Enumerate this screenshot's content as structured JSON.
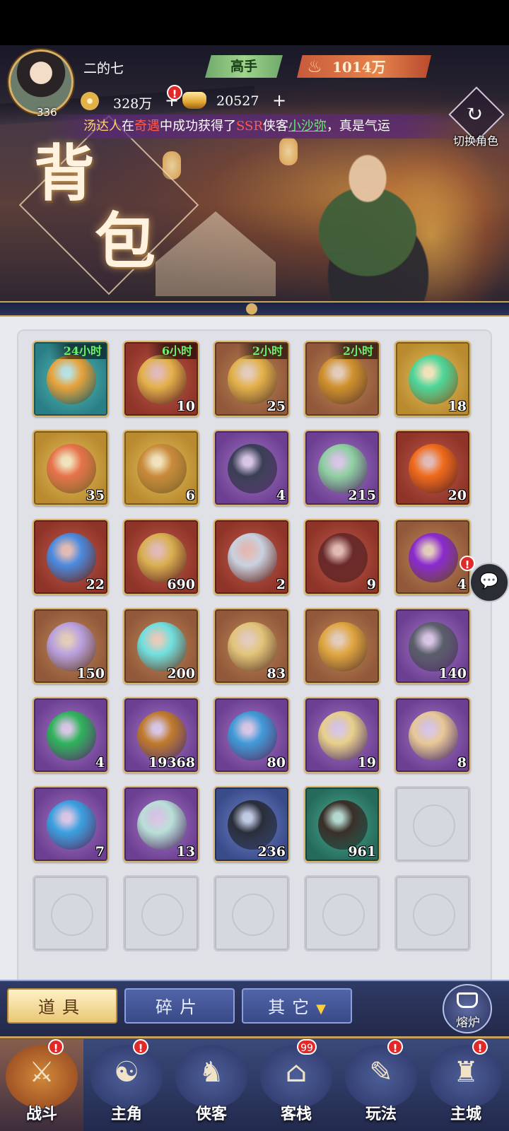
{
  "header": {
    "player_name": "二的七",
    "level": "336",
    "rank": "高手",
    "power": "1014万",
    "copper": "328万",
    "gold": "20527",
    "plus": "+",
    "alert": "!",
    "switch_role_label": "切换角色",
    "page_title_1": "背",
    "page_title_2": "包",
    "ticker": {
      "p1": "汤达人",
      "p2": "在",
      "p3": "奇遇",
      "p4": "中成功获得了",
      "p5": "SSR",
      "p6": "侠客",
      "p7": "小沙弥",
      "p8": "，真是气运"
    }
  },
  "items": [
    {
      "rarity": "teal",
      "timer": "24小时",
      "count": "",
      "icon": "gold-orbs-hourglass-icon",
      "color": "#e8a23a"
    },
    {
      "rarity": "red",
      "timer": "6小时",
      "count": "10",
      "icon": "coins-hourglass-icon",
      "color": "#e3b14a"
    },
    {
      "rarity": "orange",
      "timer": "2小时",
      "count": "25",
      "icon": "coin-hourglass-icon",
      "color": "#e3b14a"
    },
    {
      "rarity": "orange",
      "timer": "2小时",
      "count": "",
      "icon": "orbs-scroll-hourglass-icon",
      "color": "#d0902c"
    },
    {
      "rarity": "gold",
      "timer": "",
      "count": "18",
      "icon": "green-jade-icon",
      "color": "#4ed69a"
    },
    {
      "rarity": "gold",
      "timer": "",
      "count": "35",
      "icon": "hero-invite-card-icon",
      "color": "#e6724a"
    },
    {
      "rarity": "gold",
      "timer": "",
      "count": "6",
      "icon": "roast-chicken-icon",
      "color": "#c98a3a"
    },
    {
      "rarity": "purple",
      "timer": "",
      "count": "4",
      "icon": "dark-ore-icon",
      "color": "#3a3f55"
    },
    {
      "rarity": "purple",
      "timer": "",
      "count": "215",
      "icon": "recruit-book-icon",
      "color": "#8ed0a0"
    },
    {
      "rarity": "red",
      "timer": "",
      "count": "20",
      "icon": "fire-orb-icon",
      "color": "#f06a1a"
    },
    {
      "rarity": "red",
      "timer": "",
      "count": "22",
      "icon": "rainbow-crystal-icon",
      "color": "#4a8ae0"
    },
    {
      "rarity": "red",
      "timer": "",
      "count": "690",
      "icon": "scroll-roll-icon",
      "color": "#d9b050"
    },
    {
      "rarity": "red",
      "timer": "",
      "count": "2",
      "icon": "torn-cloth-icon",
      "color": "#c9d2e0"
    },
    {
      "rarity": "red",
      "timer": "",
      "count": "9",
      "icon": "wine-jar-icon",
      "color": "#6a2a2a"
    },
    {
      "rarity": "orange",
      "timer": "",
      "count": "4",
      "icon": "purple-orb-icon",
      "color": "#8a2ad0"
    },
    {
      "rarity": "orange",
      "timer": "",
      "count": "150",
      "icon": "star-cloth-icon",
      "color": "#b9a0e0"
    },
    {
      "rarity": "orange",
      "timer": "",
      "count": "200",
      "icon": "aqua-stone-icon",
      "color": "#6fe0e0"
    },
    {
      "rarity": "orange",
      "timer": "",
      "count": "83",
      "icon": "ancient-scroll-icon",
      "color": "#e2c47a"
    },
    {
      "rarity": "orange",
      "timer": "",
      "count": "",
      "icon": "gourd-icon",
      "color": "#e0a640"
    },
    {
      "rarity": "purple",
      "timer": "",
      "count": "140",
      "icon": "iron-ore-icon",
      "color": "#5a5e6a"
    },
    {
      "rarity": "purple",
      "timer": "",
      "count": "4",
      "icon": "green-orb-icon",
      "color": "#2fb35a"
    },
    {
      "rarity": "purple",
      "timer": "",
      "count": "19368",
      "icon": "bronze-orb-icon",
      "color": "#c07a2a"
    },
    {
      "rarity": "purple",
      "timer": "",
      "count": "80",
      "icon": "tri-crystal-icon",
      "color": "#3f9ad8"
    },
    {
      "rarity": "purple",
      "timer": "",
      "count": "19",
      "icon": "gold-talisman-icon",
      "color": "#e8d08a"
    },
    {
      "rarity": "purple",
      "timer": "",
      "count": "8",
      "icon": "jade-token-icon",
      "color": "#e8c896"
    },
    {
      "rarity": "purple",
      "timer": "",
      "count": "7",
      "icon": "blue-banner-icon",
      "color": "#3aa0e0"
    },
    {
      "rarity": "purple",
      "timer": "",
      "count": "13",
      "icon": "tea-jar-icon",
      "color": "#b9e0d8"
    },
    {
      "rarity": "blue",
      "timer": "",
      "count": "236",
      "icon": "flower-wine-jar-icon",
      "color": "#2a2e3a"
    },
    {
      "rarity": "green",
      "timer": "",
      "count": "961",
      "icon": "liquor-jar-icon",
      "color": "#3a2e28"
    },
    {
      "rarity": "empty",
      "timer": "",
      "count": "",
      "icon": "",
      "color": ""
    },
    {
      "rarity": "empty",
      "timer": "",
      "count": "",
      "icon": "",
      "color": ""
    },
    {
      "rarity": "empty",
      "timer": "",
      "count": "",
      "icon": "",
      "color": ""
    },
    {
      "rarity": "empty",
      "timer": "",
      "count": "",
      "icon": "",
      "color": ""
    },
    {
      "rarity": "empty",
      "timer": "",
      "count": "",
      "icon": "",
      "color": ""
    },
    {
      "rarity": "empty",
      "timer": "",
      "count": "",
      "icon": "",
      "color": ""
    }
  ],
  "tabs": {
    "items": "道具",
    "fragments": "碎片",
    "others": "其它",
    "others_caret": "▼",
    "furnace": "熔炉"
  },
  "nav": [
    {
      "label": "战斗",
      "glyph": "⚔",
      "active": true,
      "badge": "!"
    },
    {
      "label": "主角",
      "glyph": "☯",
      "active": false,
      "badge": "!"
    },
    {
      "label": "侠客",
      "glyph": "♞",
      "active": false,
      "badge": ""
    },
    {
      "label": "客栈",
      "glyph": "⌂",
      "active": false,
      "badge": "99"
    },
    {
      "label": "玩法",
      "glyph": "✎",
      "active": false,
      "badge": "!"
    },
    {
      "label": "主城",
      "glyph": "♜",
      "active": false,
      "badge": "!"
    }
  ],
  "chat_icon": "💬",
  "colors": {
    "rank_green": "#9fd48c",
    "power_orange": "#e6834c",
    "timer_green": "#6df06a",
    "tab_active": "#e9c775",
    "tab_inactive": "#3a4a88"
  }
}
